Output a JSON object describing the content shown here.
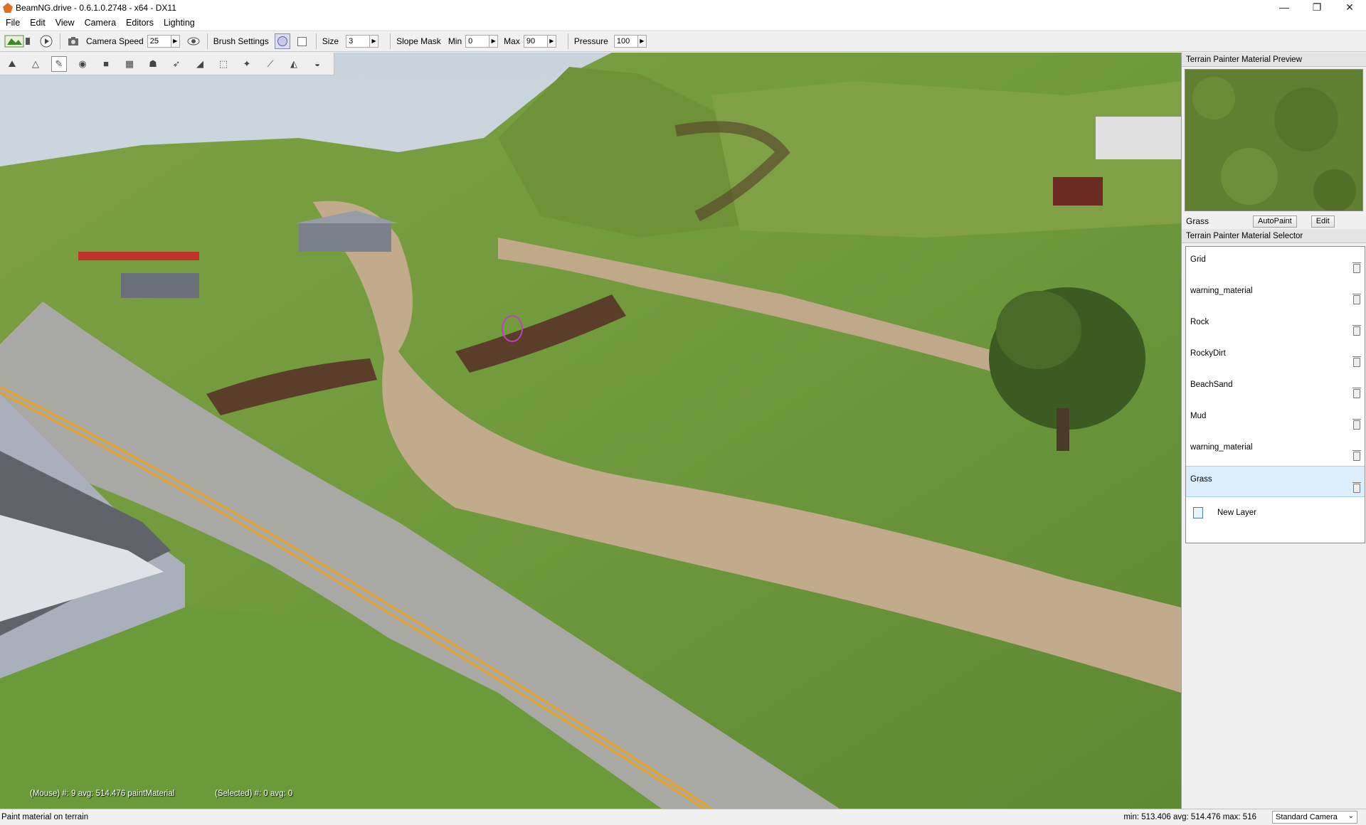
{
  "window": {
    "title": "BeamNG.drive - 0.6.1.0.2748 - x64 - DX11",
    "controls": [
      "—",
      "❐",
      "✕"
    ]
  },
  "menu": [
    "File",
    "Edit",
    "View",
    "Camera",
    "Editors",
    "Lighting"
  ],
  "toolbar": {
    "camera_speed_label": "Camera Speed",
    "camera_speed_value": "25",
    "brush_settings_label": "Brush Settings",
    "size_label": "Size",
    "size_value": "3",
    "slope_mask_label": "Slope Mask",
    "min_label": "Min",
    "min_value": "0",
    "max_label": "Max",
    "max_value": "90",
    "pressure_label": "Pressure",
    "pressure_value": "100"
  },
  "viewport": {
    "hud_mouse": "(Mouse) #: 9   avg: 514.476 paintMaterial",
    "hud_selected": "(Selected) #: 0   avg: 0"
  },
  "preview_panel": {
    "title": "Terrain Painter Material Preview",
    "material_name": "Grass",
    "autopaint_label": "AutoPaint",
    "edit_label": "Edit"
  },
  "selector_panel": {
    "title": "Terrain Painter Material Selector",
    "materials": [
      "Grid",
      "warning_material",
      "Rock",
      "RockyDirt",
      "BeachSand",
      "Mud",
      "warning_material",
      "Grass"
    ],
    "new_layer_label": "New Layer"
  },
  "statusbar": {
    "message": "Paint material on terrain",
    "stats": "min: 513.406  avg: 514.476  max: 516",
    "camera_mode": "Standard Camera"
  }
}
